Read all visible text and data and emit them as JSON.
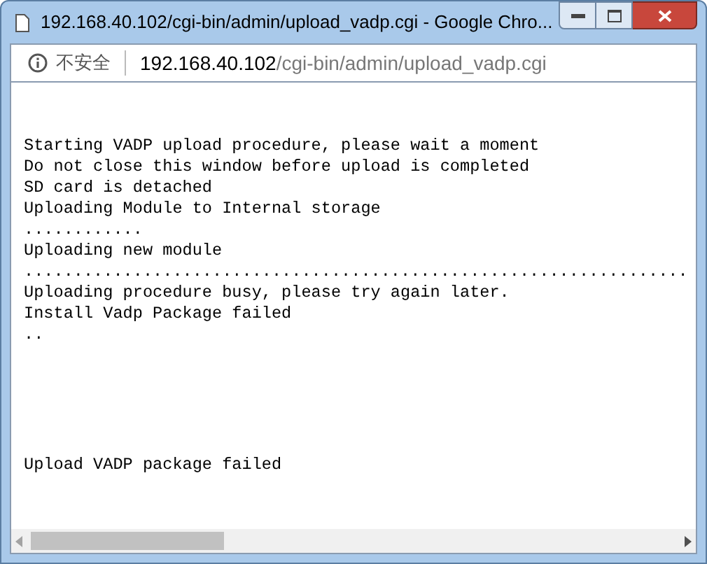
{
  "window": {
    "title": "192.168.40.102/cgi-bin/admin/upload_vadp.cgi - Google Chro..."
  },
  "address_bar": {
    "security_label": "不安全",
    "host": "192.168.40.102",
    "path": "/cgi-bin/admin/upload_vadp.cgi"
  },
  "content": {
    "lines": [
      "Starting VADP upload procedure, please wait a moment",
      "Do not close this window before upload is completed",
      "SD card is detached",
      "Uploading Module to Internal storage",
      "............",
      "Uploading new module",
      "...................................................................",
      "Uploading procedure busy, please try again later.",
      "Install Vadp Package failed",
      ".."
    ],
    "final_message": "Upload VADP package failed"
  }
}
